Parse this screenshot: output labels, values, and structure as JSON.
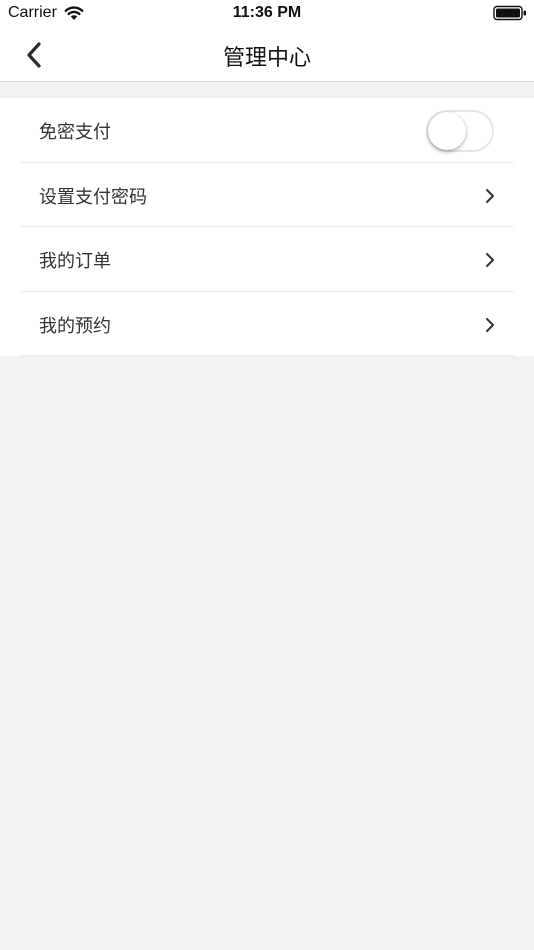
{
  "status_bar": {
    "carrier": "Carrier",
    "time": "11:36 PM"
  },
  "nav": {
    "title": "管理中心",
    "back_icon": "chevron-left-icon"
  },
  "settings": {
    "rows": [
      {
        "label": "免密支付",
        "control": "toggle",
        "toggle_on": false
      },
      {
        "label": "设置支付密码",
        "control": "chevron"
      },
      {
        "label": "我的订单",
        "control": "chevron"
      },
      {
        "label": "我的预约",
        "control": "chevron"
      }
    ]
  },
  "colors": {
    "background": "#f2f2f2",
    "card": "#ffffff",
    "divider": "#ececec",
    "text": "#333333"
  }
}
